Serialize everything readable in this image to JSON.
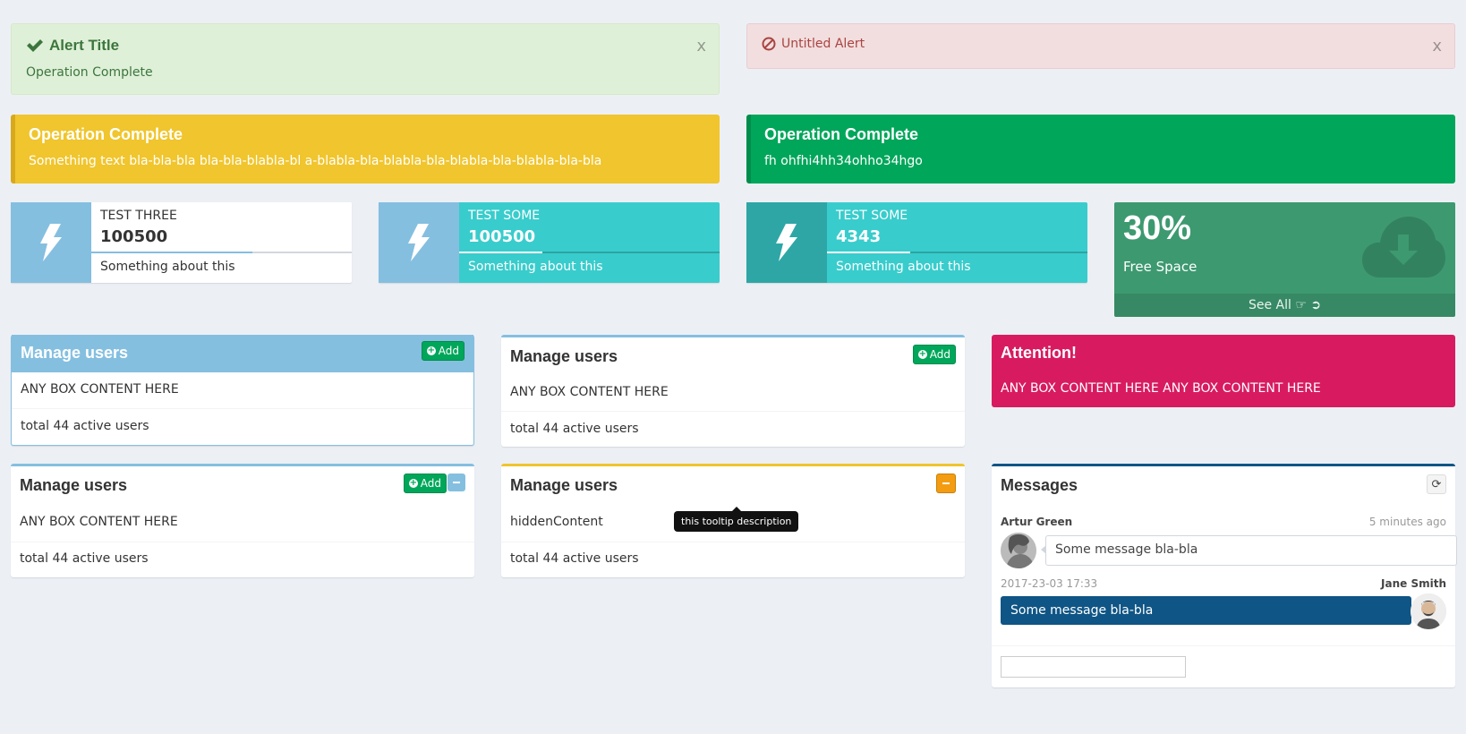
{
  "alerts": {
    "success": {
      "title": "Alert Title",
      "text": "Operation Complete",
      "close": "x",
      "icon": "check-icon"
    },
    "danger": {
      "title": "Untitled Alert",
      "close": "x",
      "icon": "ban-icon"
    }
  },
  "callouts": {
    "warning": {
      "title": "Operation Complete",
      "text": "Something text bla-bla-bla bla-bla-blabla-bl a-blabla-bla-blabla-bla-blabla-bla-blabla-bla-bla",
      "color": "#f0c52d"
    },
    "success": {
      "title": "Operation Complete",
      "text": "fh ohfhi4hh34ohho34hgo",
      "color": "#00a65a"
    }
  },
  "info_boxes": [
    {
      "label": "TEST THREE",
      "number": "100500",
      "description": "Something about this",
      "progress": 0.5,
      "icon": "bolt-icon",
      "icon_bg": "#85bfe0",
      "bg": "#ffffff"
    },
    {
      "label": "TEST SOME",
      "number": "100500",
      "description": "Something about this",
      "progress": 0.32,
      "icon": "bolt-icon",
      "icon_bg": "#85bfe0",
      "bg": "#39cccc"
    },
    {
      "label": "TEST SOME",
      "number": "4343",
      "description": "Something about this",
      "progress": 0.32,
      "icon": "bolt-icon",
      "icon_bg": "#2ea6a6",
      "bg": "#39cccc"
    }
  ],
  "small_box": {
    "value": "30%",
    "label": "Free Space",
    "footer": "See All",
    "icon": "cloud-download-icon",
    "bg": "#3d9970"
  },
  "boxes": {
    "b1": {
      "title": "Manage users",
      "add": "Add",
      "content": "ANY BOX CONTENT HERE",
      "footer": "total 44 active users"
    },
    "b2": {
      "title": "Manage users",
      "add": "Add",
      "content": "ANY BOX CONTENT HERE",
      "footer": "total 44 active users"
    },
    "attention": {
      "title": "Attention!",
      "content": "ANY BOX CONTENT HERE ANY BOX CONTENT HERE",
      "bg": "#d81b60"
    },
    "b4": {
      "title": "Manage users",
      "add": "Add",
      "content": "ANY BOX CONTENT HERE",
      "footer": "total 44 active users"
    },
    "b5": {
      "title": "Manage users",
      "content": "hiddenContent",
      "footer": "total 44 active users",
      "tooltip": "this tooltip description"
    }
  },
  "chat": {
    "title": "Messages",
    "messages": [
      {
        "name": "Artur Green",
        "time": "5 minutes ago",
        "text": "Some message bla-bla"
      },
      {
        "name": "Jane Smith",
        "time": "2017-23-03 17:33",
        "text": "Some message bla-bla"
      }
    ],
    "input_placeholder": ""
  }
}
